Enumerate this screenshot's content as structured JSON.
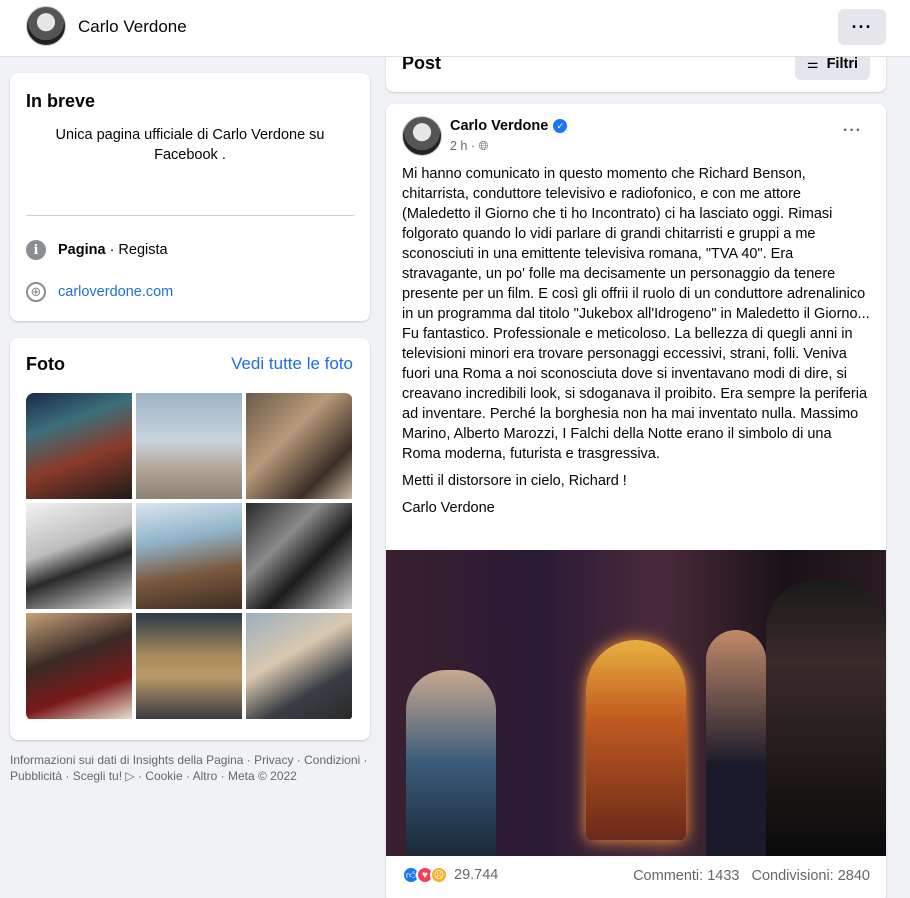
{
  "topbar": {
    "page_name": "Carlo Verdone",
    "more_label": "···"
  },
  "intro": {
    "title": "In breve",
    "description": "Unica pagina ufficiale di Carlo Verdone su Facebook .",
    "category_bold": "Pagina",
    "category_rest": " · Regista",
    "website": "carloverdone.com"
  },
  "photos": {
    "title": "Foto",
    "see_all": "Vedi tutte le foto"
  },
  "footer": "Informazioni sui dati di Insights della Pagina · Privacy · Condizioni · Pubblicità · Scegli tu! ▷ · Cookie · Altro · Meta © 2022",
  "posts_header": {
    "title": "Post",
    "filter_label": "Filtri"
  },
  "post": {
    "author": "Carlo Verdone",
    "time": "2 h ·",
    "paragraphs": [
      "Mi hanno comunicato in questo momento che Richard Benson, chitarrista, conduttore televisivo e radiofonico, e con me attore (Maledetto il Giorno che ti ho Incontrato) ci ha lasciato oggi. Rimasi folgorato quando lo vidi parlare di grandi chitarristi e gruppi a me sconosciuti in una emittente televisiva romana, \"TVA 40\". Era stravagante, un po' folle ma decisamente un personaggio da tenere presente per un film. E così gli offrii il ruolo di un conduttore adrenalinico in un programma dal titolo \"Jukebox all'Idrogeno\" in Maledetto il Giorno... Fu fantastico. Professionale e meticoloso. La bellezza di quegli anni in televisioni minori era trovare personaggi eccessivi, strani, folli. Veniva fuori una Roma a noi sconosciuta dove si inventavano modi di dire, si creavano incredibili look, si sdoganava il proibito. Era sempre la periferia ad inventare. Perché la borghesia non ha mai inventato nulla. Massimo Marino, Alberto Marozzi, I Falchi della Notte erano il simbolo di una Roma moderna, futurista e trasgressiva.",
      "Metti il distorsore in cielo, Richard !",
      "Carlo Verdone"
    ],
    "reactions_count": "29.744",
    "comments": "Commenti: 1433",
    "shares": "Condivisioni: 2840"
  }
}
